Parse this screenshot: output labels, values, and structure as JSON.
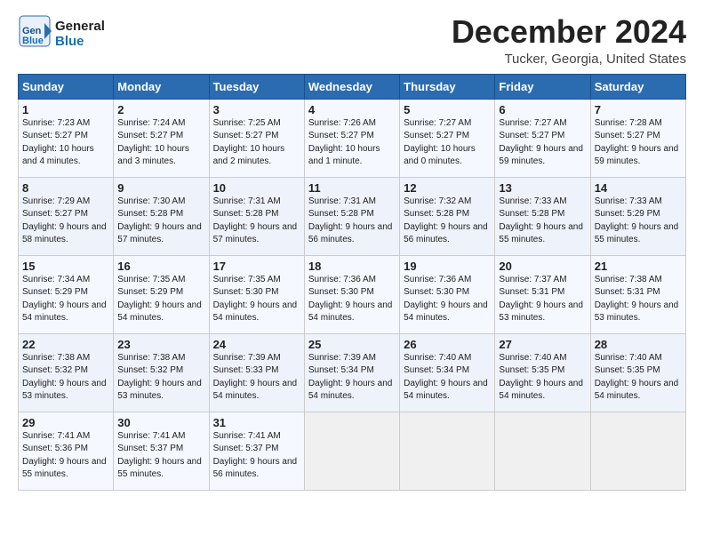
{
  "logo": {
    "line1": "General",
    "line2": "Blue",
    "arrow": "▶"
  },
  "title": "December 2024",
  "location": "Tucker, Georgia, United States",
  "days_of_week": [
    "Sunday",
    "Monday",
    "Tuesday",
    "Wednesday",
    "Thursday",
    "Friday",
    "Saturday"
  ],
  "weeks": [
    [
      {
        "num": "1",
        "sunrise": "Sunrise: 7:23 AM",
        "sunset": "Sunset: 5:27 PM",
        "daylight": "Daylight: 10 hours and 4 minutes."
      },
      {
        "num": "2",
        "sunrise": "Sunrise: 7:24 AM",
        "sunset": "Sunset: 5:27 PM",
        "daylight": "Daylight: 10 hours and 3 minutes."
      },
      {
        "num": "3",
        "sunrise": "Sunrise: 7:25 AM",
        "sunset": "Sunset: 5:27 PM",
        "daylight": "Daylight: 10 hours and 2 minutes."
      },
      {
        "num": "4",
        "sunrise": "Sunrise: 7:26 AM",
        "sunset": "Sunset: 5:27 PM",
        "daylight": "Daylight: 10 hours and 1 minute."
      },
      {
        "num": "5",
        "sunrise": "Sunrise: 7:27 AM",
        "sunset": "Sunset: 5:27 PM",
        "daylight": "Daylight: 10 hours and 0 minutes."
      },
      {
        "num": "6",
        "sunrise": "Sunrise: 7:27 AM",
        "sunset": "Sunset: 5:27 PM",
        "daylight": "Daylight: 9 hours and 59 minutes."
      },
      {
        "num": "7",
        "sunrise": "Sunrise: 7:28 AM",
        "sunset": "Sunset: 5:27 PM",
        "daylight": "Daylight: 9 hours and 59 minutes."
      }
    ],
    [
      {
        "num": "8",
        "sunrise": "Sunrise: 7:29 AM",
        "sunset": "Sunset: 5:27 PM",
        "daylight": "Daylight: 9 hours and 58 minutes."
      },
      {
        "num": "9",
        "sunrise": "Sunrise: 7:30 AM",
        "sunset": "Sunset: 5:28 PM",
        "daylight": "Daylight: 9 hours and 57 minutes."
      },
      {
        "num": "10",
        "sunrise": "Sunrise: 7:31 AM",
        "sunset": "Sunset: 5:28 PM",
        "daylight": "Daylight: 9 hours and 57 minutes."
      },
      {
        "num": "11",
        "sunrise": "Sunrise: 7:31 AM",
        "sunset": "Sunset: 5:28 PM",
        "daylight": "Daylight: 9 hours and 56 minutes."
      },
      {
        "num": "12",
        "sunrise": "Sunrise: 7:32 AM",
        "sunset": "Sunset: 5:28 PM",
        "daylight": "Daylight: 9 hours and 56 minutes."
      },
      {
        "num": "13",
        "sunrise": "Sunrise: 7:33 AM",
        "sunset": "Sunset: 5:28 PM",
        "daylight": "Daylight: 9 hours and 55 minutes."
      },
      {
        "num": "14",
        "sunrise": "Sunrise: 7:33 AM",
        "sunset": "Sunset: 5:29 PM",
        "daylight": "Daylight: 9 hours and 55 minutes."
      }
    ],
    [
      {
        "num": "15",
        "sunrise": "Sunrise: 7:34 AM",
        "sunset": "Sunset: 5:29 PM",
        "daylight": "Daylight: 9 hours and 54 minutes."
      },
      {
        "num": "16",
        "sunrise": "Sunrise: 7:35 AM",
        "sunset": "Sunset: 5:29 PM",
        "daylight": "Daylight: 9 hours and 54 minutes."
      },
      {
        "num": "17",
        "sunrise": "Sunrise: 7:35 AM",
        "sunset": "Sunset: 5:30 PM",
        "daylight": "Daylight: 9 hours and 54 minutes."
      },
      {
        "num": "18",
        "sunrise": "Sunrise: 7:36 AM",
        "sunset": "Sunset: 5:30 PM",
        "daylight": "Daylight: 9 hours and 54 minutes."
      },
      {
        "num": "19",
        "sunrise": "Sunrise: 7:36 AM",
        "sunset": "Sunset: 5:30 PM",
        "daylight": "Daylight: 9 hours and 54 minutes."
      },
      {
        "num": "20",
        "sunrise": "Sunrise: 7:37 AM",
        "sunset": "Sunset: 5:31 PM",
        "daylight": "Daylight: 9 hours and 53 minutes."
      },
      {
        "num": "21",
        "sunrise": "Sunrise: 7:38 AM",
        "sunset": "Sunset: 5:31 PM",
        "daylight": "Daylight: 9 hours and 53 minutes."
      }
    ],
    [
      {
        "num": "22",
        "sunrise": "Sunrise: 7:38 AM",
        "sunset": "Sunset: 5:32 PM",
        "daylight": "Daylight: 9 hours and 53 minutes."
      },
      {
        "num": "23",
        "sunrise": "Sunrise: 7:38 AM",
        "sunset": "Sunset: 5:32 PM",
        "daylight": "Daylight: 9 hours and 53 minutes."
      },
      {
        "num": "24",
        "sunrise": "Sunrise: 7:39 AM",
        "sunset": "Sunset: 5:33 PM",
        "daylight": "Daylight: 9 hours and 54 minutes."
      },
      {
        "num": "25",
        "sunrise": "Sunrise: 7:39 AM",
        "sunset": "Sunset: 5:34 PM",
        "daylight": "Daylight: 9 hours and 54 minutes."
      },
      {
        "num": "26",
        "sunrise": "Sunrise: 7:40 AM",
        "sunset": "Sunset: 5:34 PM",
        "daylight": "Daylight: 9 hours and 54 minutes."
      },
      {
        "num": "27",
        "sunrise": "Sunrise: 7:40 AM",
        "sunset": "Sunset: 5:35 PM",
        "daylight": "Daylight: 9 hours and 54 minutes."
      },
      {
        "num": "28",
        "sunrise": "Sunrise: 7:40 AM",
        "sunset": "Sunset: 5:35 PM",
        "daylight": "Daylight: 9 hours and 54 minutes."
      }
    ],
    [
      {
        "num": "29",
        "sunrise": "Sunrise: 7:41 AM",
        "sunset": "Sunset: 5:36 PM",
        "daylight": "Daylight: 9 hours and 55 minutes."
      },
      {
        "num": "30",
        "sunrise": "Sunrise: 7:41 AM",
        "sunset": "Sunset: 5:37 PM",
        "daylight": "Daylight: 9 hours and 55 minutes."
      },
      {
        "num": "31",
        "sunrise": "Sunrise: 7:41 AM",
        "sunset": "Sunset: 5:37 PM",
        "daylight": "Daylight: 9 hours and 56 minutes."
      },
      null,
      null,
      null,
      null
    ]
  ]
}
